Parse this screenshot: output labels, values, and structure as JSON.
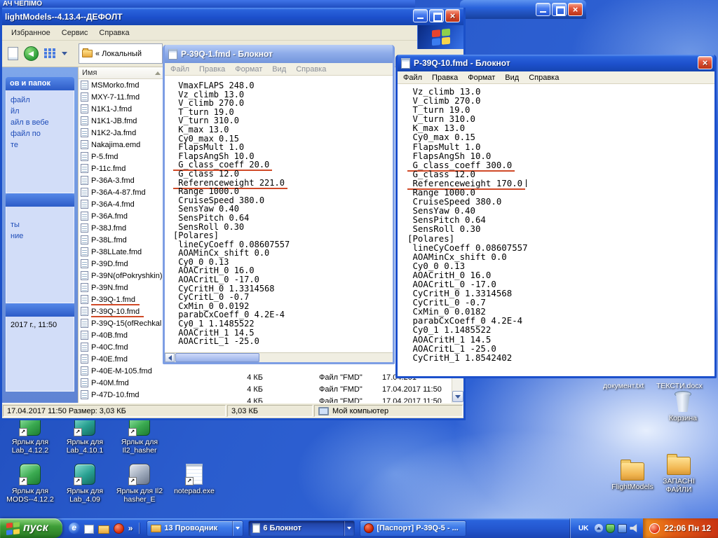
{
  "annotation_color": "#d04a28",
  "background_strip": {
    "title": "АЧ ЧЕПІМО"
  },
  "explorer": {
    "title": "lightModels--4.13.4--ДЕФОЛТ",
    "menu": [
      "Избранное",
      "Сервис",
      "Справка"
    ],
    "address": "« Локальный",
    "list_header": "Имя",
    "sidebar_sections": [
      {
        "header": "ов и папок",
        "items": [
          {
            "text": "файл"
          },
          {
            "text": "йл"
          },
          {
            "text": "айл в вебе"
          },
          {
            "text": "файл по"
          },
          {
            "text": "те"
          }
        ]
      },
      {
        "header": "",
        "items": [
          {
            "text": "ты"
          },
          {
            "text": "ние"
          }
        ]
      },
      {
        "header": "",
        "items": [
          {
            "text": "2017 г., 11:50",
            "plain": true
          }
        ]
      }
    ],
    "files": [
      {
        "name": "MSMorko.fmd"
      },
      {
        "name": "MXY-7-11.fmd"
      },
      {
        "name": "N1K1-J.fmd"
      },
      {
        "name": "N1K1-JB.fmd"
      },
      {
        "name": "N1K2-Ja.fmd"
      },
      {
        "name": "Nakajima.emd"
      },
      {
        "name": "P-5.fmd"
      },
      {
        "name": "P-11c.fmd"
      },
      {
        "name": "P-36A-3.fmd"
      },
      {
        "name": "P-36A-4-87.fmd"
      },
      {
        "name": "P-36A-4.fmd"
      },
      {
        "name": "P-36A.fmd"
      },
      {
        "name": "P-38J.fmd"
      },
      {
        "name": "P-38L.fmd"
      },
      {
        "name": "P-38LLate.fmd"
      },
      {
        "name": "P-39D.fmd"
      },
      {
        "name": "P-39N(ofPokryshkin)"
      },
      {
        "name": "P-39N.fmd"
      },
      {
        "name": "P-39Q-1.fmd",
        "marked": true
      },
      {
        "name": "P-39Q-10.fmd",
        "marked": true
      },
      {
        "name": "P-39Q-15(ofRechkal"
      },
      {
        "name": "P-40B.fmd"
      },
      {
        "name": "P-40C.fmd"
      },
      {
        "name": "P-40E.fmd"
      },
      {
        "name": "P-40E-M-105.fmd"
      },
      {
        "name": "P-40M.fmd"
      },
      {
        "name": "P-47D-10.fmd"
      }
    ],
    "details_rows": [
      {
        "size": "4 КБ",
        "type": "Файл \"FMD\"",
        "date": "17.04.201"
      },
      {
        "size": "4 КБ",
        "type": "Файл \"FMD\"",
        "date": "17.04.2017 11:50"
      },
      {
        "size": "4 КБ",
        "type": "Файл \"FMD\"",
        "date": "17.04.2017 11:50"
      }
    ],
    "status_left": "17.04.2017 11:50 Размер: 3,03 КБ",
    "status_size": "3,03 КБ",
    "status_zone": "Мой компьютер"
  },
  "notepad1": {
    "title": "P-39Q-1.fmd - Блокнот",
    "menu": [
      "Файл",
      "Правка",
      "Формат",
      "Вид",
      "Справка"
    ],
    "lines": [
      {
        "text": " VmaxFLAPS 248.0"
      },
      {
        "text": " Vz_climb 13.0"
      },
      {
        "text": " V_climb 270.0"
      },
      {
        "text": " T_turn 19.0"
      },
      {
        "text": " V_turn 310.0"
      },
      {
        "text": " K_max 13.0"
      },
      {
        "text": " Cy0_max 0.15"
      },
      {
        "text": " FlapsMult 1.0"
      },
      {
        "text": " FlapsAngSh 10.0"
      },
      {
        "text": " G_class_coeff 20.0",
        "marked": true
      },
      {
        "text": " G_class 12.0"
      },
      {
        "text": " Referenceweight 221.0",
        "marked": true
      },
      {
        "text": " Range 1000.0"
      },
      {
        "text": " CruiseSpeed 380.0"
      },
      {
        "text": " SensYaw 0.40"
      },
      {
        "text": " SensPitch 0.64"
      },
      {
        "text": " SensRoll 0.30"
      },
      {
        "text": "[Polares]"
      },
      {
        "text": " lineCyCoeff 0.08607557"
      },
      {
        "text": " AOAMinCx_shift 0.0"
      },
      {
        "text": " Cy0_0 0.13"
      },
      {
        "text": " AOACritH_0 16.0"
      },
      {
        "text": " AOACritL_0 -17.0"
      },
      {
        "text": " CyCritH_0 1.3314568"
      },
      {
        "text": " CyCritL_0 -0.7"
      },
      {
        "text": " CxMin_0 0.0192"
      },
      {
        "text": " parabCxCoeff_0 4.2E-4"
      },
      {
        "text": " Cy0_1 1.1485522"
      },
      {
        "text": " AOACritH_1 14.5"
      },
      {
        "text": " AOACritL_1 -25.0"
      }
    ]
  },
  "notepad2": {
    "title": "P-39Q-10.fmd - Блокнот",
    "menu": [
      "Файл",
      "Правка",
      "Формат",
      "Вид",
      "Справка"
    ],
    "lines": [
      {
        "text": " Vz_climb 13.0"
      },
      {
        "text": " V_climb 270.0"
      },
      {
        "text": " T_turn 19.0"
      },
      {
        "text": " V_turn 310.0"
      },
      {
        "text": " K_max 13.0"
      },
      {
        "text": " Cy0_max 0.15"
      },
      {
        "text": " FlapsMult 1.0"
      },
      {
        "text": " FlapsAngSh 10.0"
      },
      {
        "text": " G_class_coeff 300.0",
        "marked": true
      },
      {
        "text": " G_class 12.0"
      },
      {
        "text": " Referenceweight 170.0",
        "marked": true,
        "caret": true
      },
      {
        "text": " Range 1000.0"
      },
      {
        "text": " CruiseSpeed 380.0"
      },
      {
        "text": " SensYaw 0.40"
      },
      {
        "text": " SensPitch 0.64"
      },
      {
        "text": " SensRoll 0.30"
      },
      {
        "text": "[Polares]"
      },
      {
        "text": " lineCyCoeff 0.08607557"
      },
      {
        "text": " AOAMinCx_shift 0.0"
      },
      {
        "text": " Cy0_0 0.13"
      },
      {
        "text": " AOACritH_0 16.0"
      },
      {
        "text": " AOACritL_0 -17.0"
      },
      {
        "text": " CyCritH_0 1.3314568"
      },
      {
        "text": " CyCritL_0 -0.7"
      },
      {
        "text": " CxMin_0 0.0182"
      },
      {
        "text": " parabCxCoeff_0 4.2E-4"
      },
      {
        "text": " Cy0_1 1.1485522"
      },
      {
        "text": " AOACritH_1 14.5"
      },
      {
        "text": " AOACritL_1 -25.0"
      },
      {
        "text": " CyCritH_1 1.8542402"
      }
    ]
  },
  "desktop": {
    "doc_labels": [
      "документ.txt",
      "ТЕКСТИ.docx"
    ],
    "recycle_label": "Корзина",
    "folder1_label": "FlightModels",
    "folder2_label": "ЗАПАСНІ ФАЙЛИ",
    "left_row1": [
      {
        "label": "Ярлык для Lab_4.12.2",
        "type": "app-green"
      },
      {
        "label": "Ярлык для Lab_4.10.1",
        "type": "app-teal"
      },
      {
        "label": "Ярлык для Il2_hasher",
        "type": "app-green"
      }
    ],
    "left_row2": [
      {
        "label": "Ярлык для MODS--4.12.2",
        "type": "app-green"
      },
      {
        "label": "Ярлык для Lab_4.09",
        "type": "app-teal"
      },
      {
        "label": "Ярлык для Il2 hasher_E",
        "type": "app-gray"
      },
      {
        "label": "notepad.exe",
        "type": "notepad-pad"
      }
    ]
  },
  "taskbar": {
    "start_label": "пуск",
    "quick_launch": [
      "ie-icon",
      "show-desktop-icon",
      "folder-icon",
      "red-app-icon",
      "overflow-chevron"
    ],
    "buttons": [
      {
        "label": "13 Проводник",
        "icon": "folder",
        "state": "normal",
        "dropdown": true
      },
      {
        "label": "6 Блокнот",
        "icon": "notepad",
        "state": "pressed",
        "dropdown": true
      },
      {
        "label": "[Паспорт] P-39Q-5 - ...",
        "icon": "red-app",
        "state": "normal",
        "dropdown": false
      }
    ],
    "tray_lang": "UK",
    "tray_icons": [
      "hide-icons-icon",
      "shield-icon",
      "network-icon",
      "volume-icon"
    ],
    "clock": "22:06 Пн 12"
  }
}
